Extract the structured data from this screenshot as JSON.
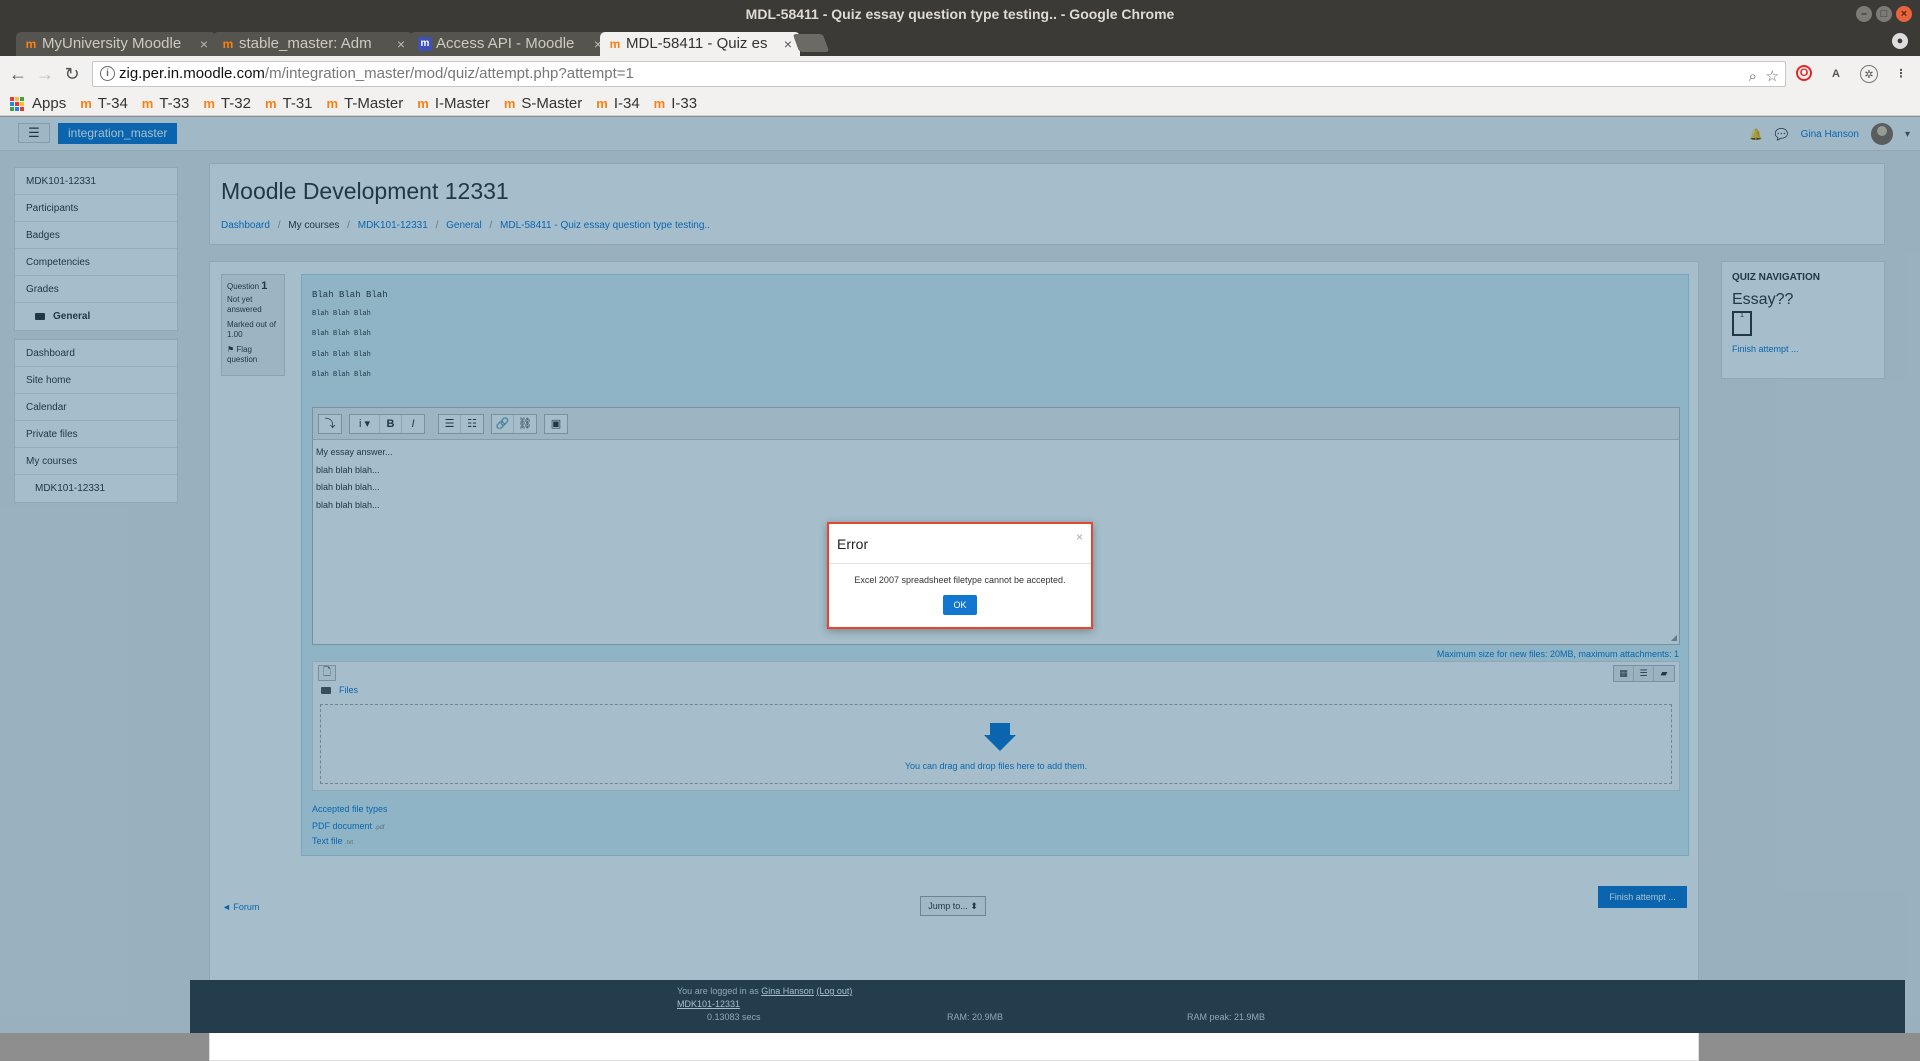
{
  "window": {
    "title": "MDL-58411 - Quiz essay question type testing.. - Google Chrome"
  },
  "tabs": [
    {
      "label": "MyUniversity Moodle"
    },
    {
      "label": "stable_master: Adm"
    },
    {
      "label": "Access API - Moodle"
    },
    {
      "label": "MDL-58411 - Quiz es"
    }
  ],
  "url": {
    "host": "zig.per.in.moodle.com",
    "path": "/m/integration_master/mod/quiz/attempt.php?attempt=1"
  },
  "bookmarks": {
    "apps": "Apps",
    "items": [
      "T-34",
      "T-33",
      "T-32",
      "T-31",
      "T-Master",
      "I-Master",
      "S-Master",
      "I-34",
      "I-33"
    ]
  },
  "moodle": {
    "brand": "integration_master",
    "user": "Gina Hanson",
    "sidebar_group1": [
      "MDK101-12331",
      "Participants",
      "Badges",
      "Competencies",
      "Grades"
    ],
    "sidebar_general": "General",
    "sidebar_group2": [
      "Dashboard",
      "Site home",
      "Calendar",
      "Private files",
      "My courses"
    ],
    "sidebar_course": "MDK101-12331",
    "page_title": "Moodle Development 12331",
    "breadcrumbs": {
      "dashboard": "Dashboard",
      "my_courses": "My courses",
      "course": "MDK101-12331",
      "general": "General",
      "quiz": "MDL-58411 - Quiz essay question type testing.."
    }
  },
  "question": {
    "label": "Question",
    "number": "1",
    "status": "Not yet answered",
    "marks": "Marked out of 1.00",
    "flag": "Flag question",
    "text_heading": "Blah Blah Blah",
    "text_lines": [
      "Blah Blah Blah",
      "Blah Blah Blah",
      "Blah Blah Blah",
      "Blah Blah Blah"
    ]
  },
  "editor": {
    "toolbar": {
      "collapse": "⤵",
      "info": "i ▾",
      "bold": "B",
      "italic": "I",
      "ul": "☰",
      "ol": "☷",
      "link": "🔗",
      "unlink": "⛓",
      "image": "▣"
    },
    "lines": [
      "My essay answer...",
      "blah blah blah...",
      "blah blah blah...",
      "blah blah blah..."
    ]
  },
  "filepicker": {
    "max_size": "Maximum size for new files: 20MB, maximum attachments: 1",
    "files_label": "Files",
    "drop_text": "You can drag and drop files here to add them.",
    "accepted_title": "Accepted file types",
    "accepted": [
      {
        "name": "PDF document",
        "ext": ".pdf"
      },
      {
        "name": "Text file",
        "ext": ".txt"
      }
    ]
  },
  "actions": {
    "forum": "◄ Forum",
    "jump": "Jump to... ⬍",
    "finish": "Finish attempt ..."
  },
  "quiz_nav": {
    "title": "QUIZ NAVIGATION",
    "section": "Essay??",
    "q1": "1",
    "finish": "Finish attempt ..."
  },
  "footer": {
    "logged_in_prefix": "You are logged in as",
    "user": "Gina Hanson",
    "logout": "(Log out)",
    "course": "MDK101-12331",
    "time": "0.13083 secs",
    "ram": "RAM: 20.9MB",
    "ram_peak": "RAM peak: 21.9MB"
  },
  "modal": {
    "title": "Error",
    "message": "Excel 2007 spreadsheet filetype cannot be accepted.",
    "ok": "OK",
    "close": "×"
  }
}
